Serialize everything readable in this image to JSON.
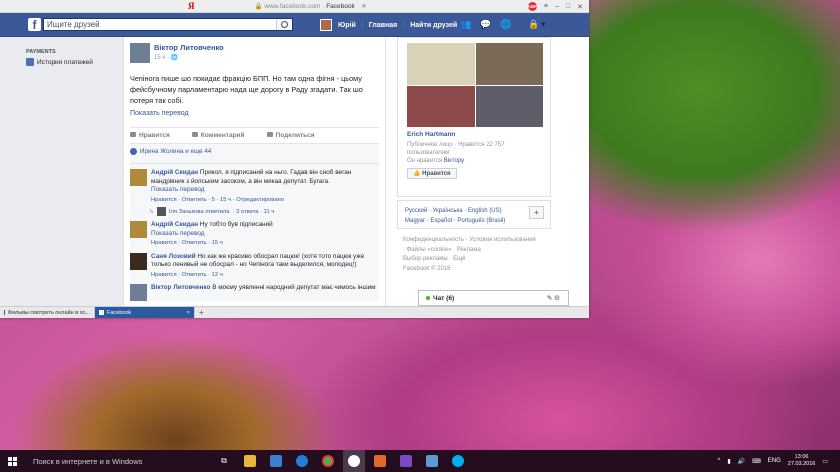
{
  "browser": {
    "logo": "Я",
    "url_host": "www.facebook.com",
    "url_title": "Facebook",
    "tabs": [
      {
        "label": "Фильмы смотреть онлайн в хо..."
      },
      {
        "label": "Facebook"
      }
    ],
    "add_tab": "+"
  },
  "fb": {
    "search_placeholder": "Ищите друзей",
    "user": "Юрій",
    "home": "Главная",
    "find_friends": "Найти друзей"
  },
  "left": {
    "section": "PAYMENTS",
    "item": "История платежей"
  },
  "post": {
    "author": "Віктор Литовченко",
    "time": "15 ч",
    "text": "Чепінога пише шо покидає фракцію БПП. Но там одна фігня - цьому фейсбучному парламентарю нада ще дорогу в Раду згадати. Так шо потеря так собі.",
    "translate": "Показать перевод",
    "like": "Нравится",
    "comment": "Комментарий",
    "share": "Поделиться",
    "likes": "Ирина Жолина и еще 44"
  },
  "comments": [
    {
      "name": "Андрій Скидан",
      "text": "Прикол, я підписаний на ньго. Гадав він сноб веган мандрівник з йопським засоком, а він мякаа депутат. Бугага.",
      "translate": "Показать перевод",
      "actions": "Нравится · Ответить · 5 · 15 ч · Отредактировано",
      "reply_name": "Іля Занькова ответила",
      "reply_count": "· 3 ответа · 11 ч"
    },
    {
      "name": "Андрій Скидан",
      "text": "Ну тобто був підписаний",
      "translate": "Показать перевод",
      "actions": "Нравится · Ответить · 15 ч"
    },
    {
      "name": "Саня Лозовий",
      "text": "Но как же красиво обосрал пацюк! (хотя тото пацюк уже только ленивый не обосрал - но Чепінога таки выделился, молодец!)",
      "actions": "Нравится · Ответить · 12 ч"
    },
    {
      "name": "Віктор Литовченко",
      "text": "В моєму уявленні народний депутат має чимось іншим"
    }
  ],
  "page_card": {
    "name": "Erich Hartmann",
    "meta": "Публичное лицо · Нравится 22 757 пользователям",
    "liked_by": "Он нравится",
    "liked_name": "Віктору",
    "button": "Нравится"
  },
  "langs": {
    "line1": "Русский · Українська · English (US)",
    "line2": "Magyar · Español · Português (Brasil)",
    "plus": "+"
  },
  "footer": [
    "Конфиденциальность · Условия использования",
    "· Файлы «cookie» · Реклама",
    "Выбор рекламы · Ещё",
    "Facebook © 2016"
  ],
  "chat": {
    "label": "Чат (6)"
  },
  "taskbar": {
    "search": "Поиск в интернете и в Windows",
    "lang": "ENG",
    "time": "13:06",
    "date": "27.03.2016"
  }
}
